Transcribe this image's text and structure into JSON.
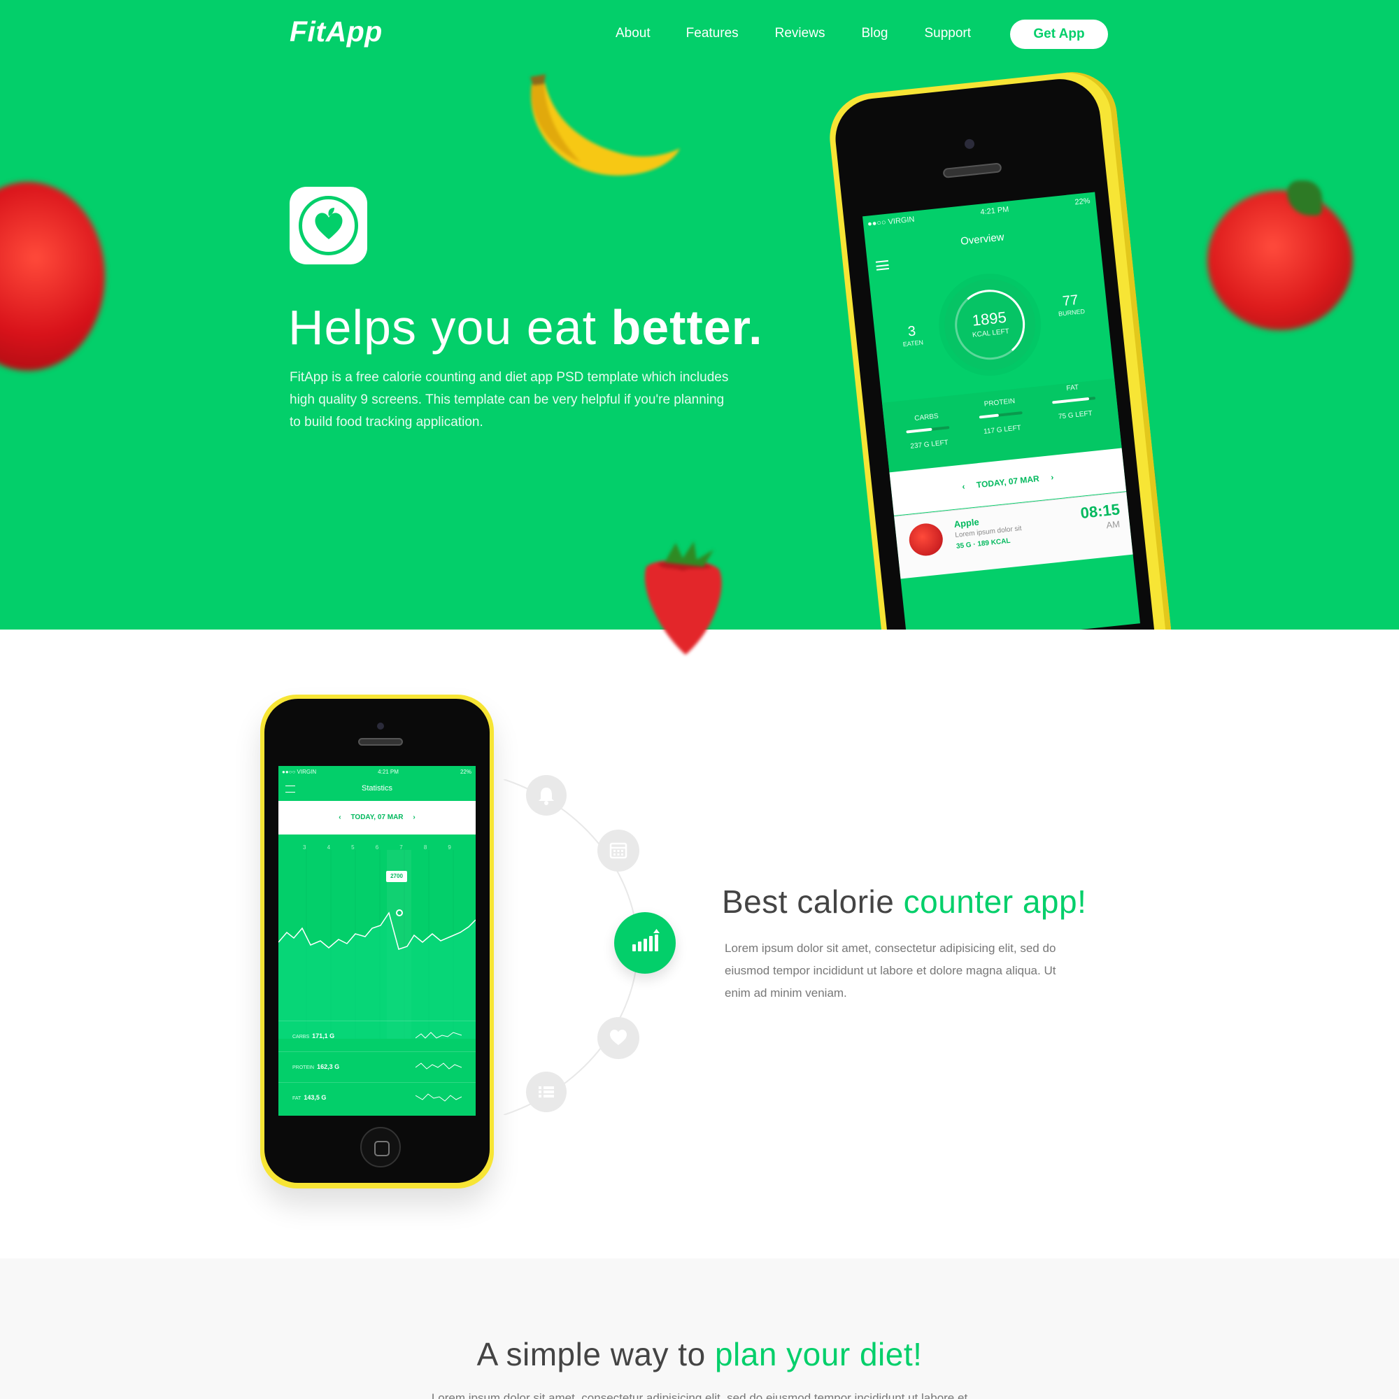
{
  "header": {
    "logo": "FitApp",
    "nav": [
      "About",
      "Features",
      "Reviews",
      "Blog",
      "Support"
    ],
    "cta": "Get App"
  },
  "hero": {
    "title_light": "Helps you eat ",
    "title_bold": "better.",
    "description": "FitApp is a free calorie counting and diet app PSD template which includes high quality 9 screens. This template can be very helpful if you're planning to build food tracking application."
  },
  "overview_screen": {
    "carrier": "●●○○ VIRGIN",
    "time": "4:21 PM",
    "battery": "22%",
    "title": "Overview",
    "eaten_value": "3",
    "eaten_label": "EATEN",
    "kcal_value": "1895",
    "kcal_label": "KCAL LEFT",
    "burned_value": "77",
    "burned_label": "BURNED",
    "macros": [
      {
        "name": "CARBS",
        "left": "237 G LEFT",
        "fill": 0.6
      },
      {
        "name": "PROTEIN",
        "left": "117 G LEFT",
        "fill": 0.45
      },
      {
        "name": "FAT",
        "left": "75 G LEFT",
        "fill": 0.85
      }
    ],
    "date": "TODAY, 07 MAR",
    "entry": {
      "name": "Apple",
      "desc": "Lorem ipsum dolor sit",
      "meta": "35 G  ·  189 KCAL",
      "time": "08:15",
      "ampm": "AM"
    }
  },
  "statistics_screen": {
    "carrier": "●●○○ VIRGIN",
    "time": "4:21 PM",
    "battery": "22%",
    "title": "Statistics",
    "date": "TODAY, 07 MAR",
    "days": [
      "3",
      "4",
      "5",
      "6",
      "7",
      "8",
      "9"
    ],
    "peak_label": "2700",
    "rows": [
      {
        "name": "CARBS",
        "value": "171,1 G"
      },
      {
        "name": "PROTEIN",
        "value": "162,3 G"
      },
      {
        "name": "FAT",
        "value": "143,5 G"
      }
    ]
  },
  "feature": {
    "title_plain": "Best calorie ",
    "title_accent": "counter app!",
    "description": "Lorem ipsum dolor sit amet, consectetur adipisicing elit, sed do eiusmod tempor incididunt ut labore et dolore magna aliqua. Ut enim ad minim veniam."
  },
  "orbit_icons": [
    "bell-icon",
    "calendar-icon",
    "stats-icon",
    "heart-icon",
    "list-icon"
  ],
  "plan": {
    "title_plain": "A simple way to ",
    "title_accent": "plan your diet!",
    "description": "Lorem ipsum dolor sit amet, consectetur adipisicing elit, sed do eiusmod tempor incididunt ut labore et"
  },
  "colors": {
    "brand_green": "#03cf6a",
    "phone_yellow": "#f7e535"
  }
}
